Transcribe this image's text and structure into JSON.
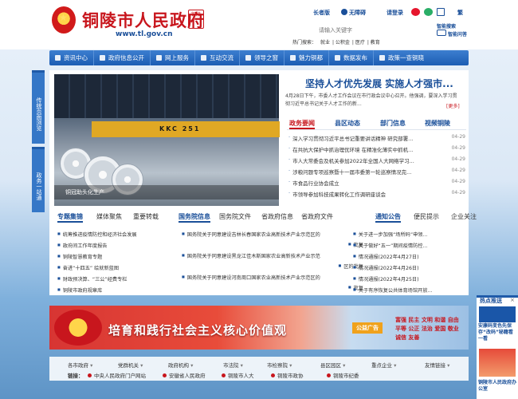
{
  "header": {
    "site_name": "铜陵市人民政府",
    "domain": "www.tl.gov.cn",
    "seal_text": "铜陵",
    "elder_label": "长者版",
    "accessible_label": "无障碍",
    "login_label": "请登录",
    "lang_label": "繁",
    "search_placeholder": "请输入关键字",
    "smart_search": "智能搜索",
    "smart_qa": "智能问答",
    "hot_label": "热门搜索：",
    "hot_words": [
      "就业",
      "公积金",
      "医疗",
      "教育"
    ]
  },
  "nav": {
    "items": [
      {
        "label": "资讯中心",
        "icon": "info-icon"
      },
      {
        "label": "政府信息公开",
        "icon": "document-icon"
      },
      {
        "label": "网上服务",
        "icon": "service-icon"
      },
      {
        "label": "互动交流",
        "icon": "chat-icon"
      },
      {
        "label": "领导之窗",
        "icon": "leader-icon"
      },
      {
        "label": "魅力铜都",
        "icon": "city-icon"
      },
      {
        "label": "数据发布",
        "icon": "data-icon"
      },
      {
        "label": "政策一查铜晓",
        "icon": "policy-icon"
      }
    ]
  },
  "side": {
    "tab1": "传统页面浏览",
    "tab2": "政务一站通"
  },
  "feature": {
    "headline": "坚持人才优先发展 实施人才强市...",
    "summary": "4月28日下午，市委人才工作会议在市行政会议中心召开。他强调，要深入学习贯彻习近平总书记关于人才工作的新...",
    "more": "[更多]",
    "photo_caption": "铜冠助头化生产",
    "crane_text": "KKC 251"
  },
  "news_tabs": [
    "政务要闻",
    "县区动态",
    "部门信息",
    "视频铜陵"
  ],
  "news": [
    {
      "title": "深入学习贯彻习近平总书记重要讲话精神 研究部署...",
      "date": "04-29"
    },
    {
      "title": "在共抗大保护中抓治理优环境 在精准化薄实中抓机...",
      "date": "04-29"
    },
    {
      "title": "市人大常委会及机关参加2022年全国人大网络学习...",
      "date": "04-29"
    },
    {
      "title": "涉粮问题专项巡察暨十一届市委第一轮巡察情况完...",
      "date": "04-29"
    },
    {
      "title": "市食品行业协会成立",
      "date": "04-29"
    },
    {
      "title": "市领导参加科技成果转化工作调研座谈会",
      "date": "04-29"
    }
  ],
  "lower": {
    "tabs1": [
      "专题集锦",
      "媒体聚焦",
      "重要转载"
    ],
    "tabs2": [
      "国务院信息",
      "国务院文件",
      "省政府信息",
      "省政府文件"
    ],
    "tabs3": [
      "通知公告",
      "便民提示",
      "企业关注"
    ],
    "list1": [
      "统筹推进疫情防控和经济社会发展",
      "政府间工作年度报告",
      "铜陵智慧教育专题",
      "奋进“十四五” 绘就新蓝图",
      "财政预决算、“三公”经费专栏",
      "铜陵市政府规章库"
    ],
    "list2": [
      {
        "title": "国务院关于同意建设吉林长春国家农业高新技术产业示范区的",
        "tail": "批复"
      },
      {
        "title": "国务院关于同意建设黑龙江佳木斯国家农业高新技术产业示范",
        "tail": "区的批复"
      },
      {
        "title": "国务院关于同意建设河南周口国家农业高新技术产业示范区的",
        "tail": "批复"
      }
    ],
    "list3": [
      {
        "title": "关于进一步加强“场所码”申领...",
        "date": ""
      },
      {
        "title": "关于做好“五一”期间疫情防控...",
        "date": ""
      },
      {
        "title": "情况通报",
        "date": "(2022年4月27日)"
      },
      {
        "title": "情况通报",
        "date": "(2022年4月26日)"
      },
      {
        "title": "情况通报",
        "date": "(2022年4月25日)"
      },
      {
        "title": "关于有序恢复公共体育场馆开放...",
        "date": ""
      }
    ]
  },
  "banner": {
    "text": "培育和践行社会主义核心价值观",
    "tag": "公益广告",
    "words": "富强 民主 文明 和谐 自由 平等 公正 法治 爱国 敬业 诚信 友善"
  },
  "footer": {
    "selects": [
      "各市政府",
      "党群机关",
      "政府机构",
      "市法院",
      "市检察院",
      "县区园区",
      "重点企业",
      "友情链接"
    ],
    "links_label": "链接：",
    "links": [
      "中央人民政府门户网站",
      "安徽省人民政府",
      "铜陵市人大",
      "铜陵市政协",
      "铜陵市纪委"
    ]
  },
  "hot": {
    "title": "热点推送",
    "close": "×",
    "item1": "安康码变色先保存“改码”秘籍看一看",
    "item2": "铜陵市人民政府办公室"
  }
}
